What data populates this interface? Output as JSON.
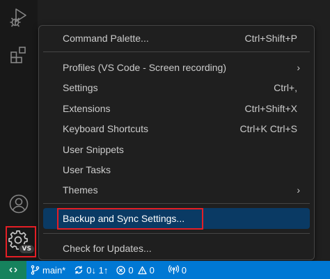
{
  "activity_bar": {
    "icons": [
      "run-debug-icon",
      "extensions-icon",
      "accounts-icon",
      "gear-icon"
    ],
    "profile_badge": "VS"
  },
  "menu": {
    "items": [
      {
        "label": "Command Palette...",
        "shortcut": "Ctrl+Shift+P"
      },
      {
        "label": "Profiles (VS Code - Screen recording)",
        "submenu": true
      },
      {
        "label": "Settings",
        "shortcut": "Ctrl+,"
      },
      {
        "label": "Extensions",
        "shortcut": "Ctrl+Shift+X"
      },
      {
        "label": "Keyboard Shortcuts",
        "shortcut": "Ctrl+K Ctrl+S"
      },
      {
        "label": "User Snippets"
      },
      {
        "label": "User Tasks"
      },
      {
        "label": "Themes",
        "submenu": true
      },
      {
        "label": "Backup and Sync Settings...",
        "highlighted": true
      },
      {
        "label": "Check for Updates..."
      }
    ],
    "chevron": "›"
  },
  "status_bar": {
    "branch": "main*",
    "sync": "0↓ 1↑",
    "errors": "0",
    "warnings": "0",
    "ports": "0"
  },
  "colors": {
    "status_bar": "#0078d4",
    "remote_indicator": "#16825d",
    "menu_highlight": "#0a3a64",
    "annotation_box": "#e51e25"
  }
}
